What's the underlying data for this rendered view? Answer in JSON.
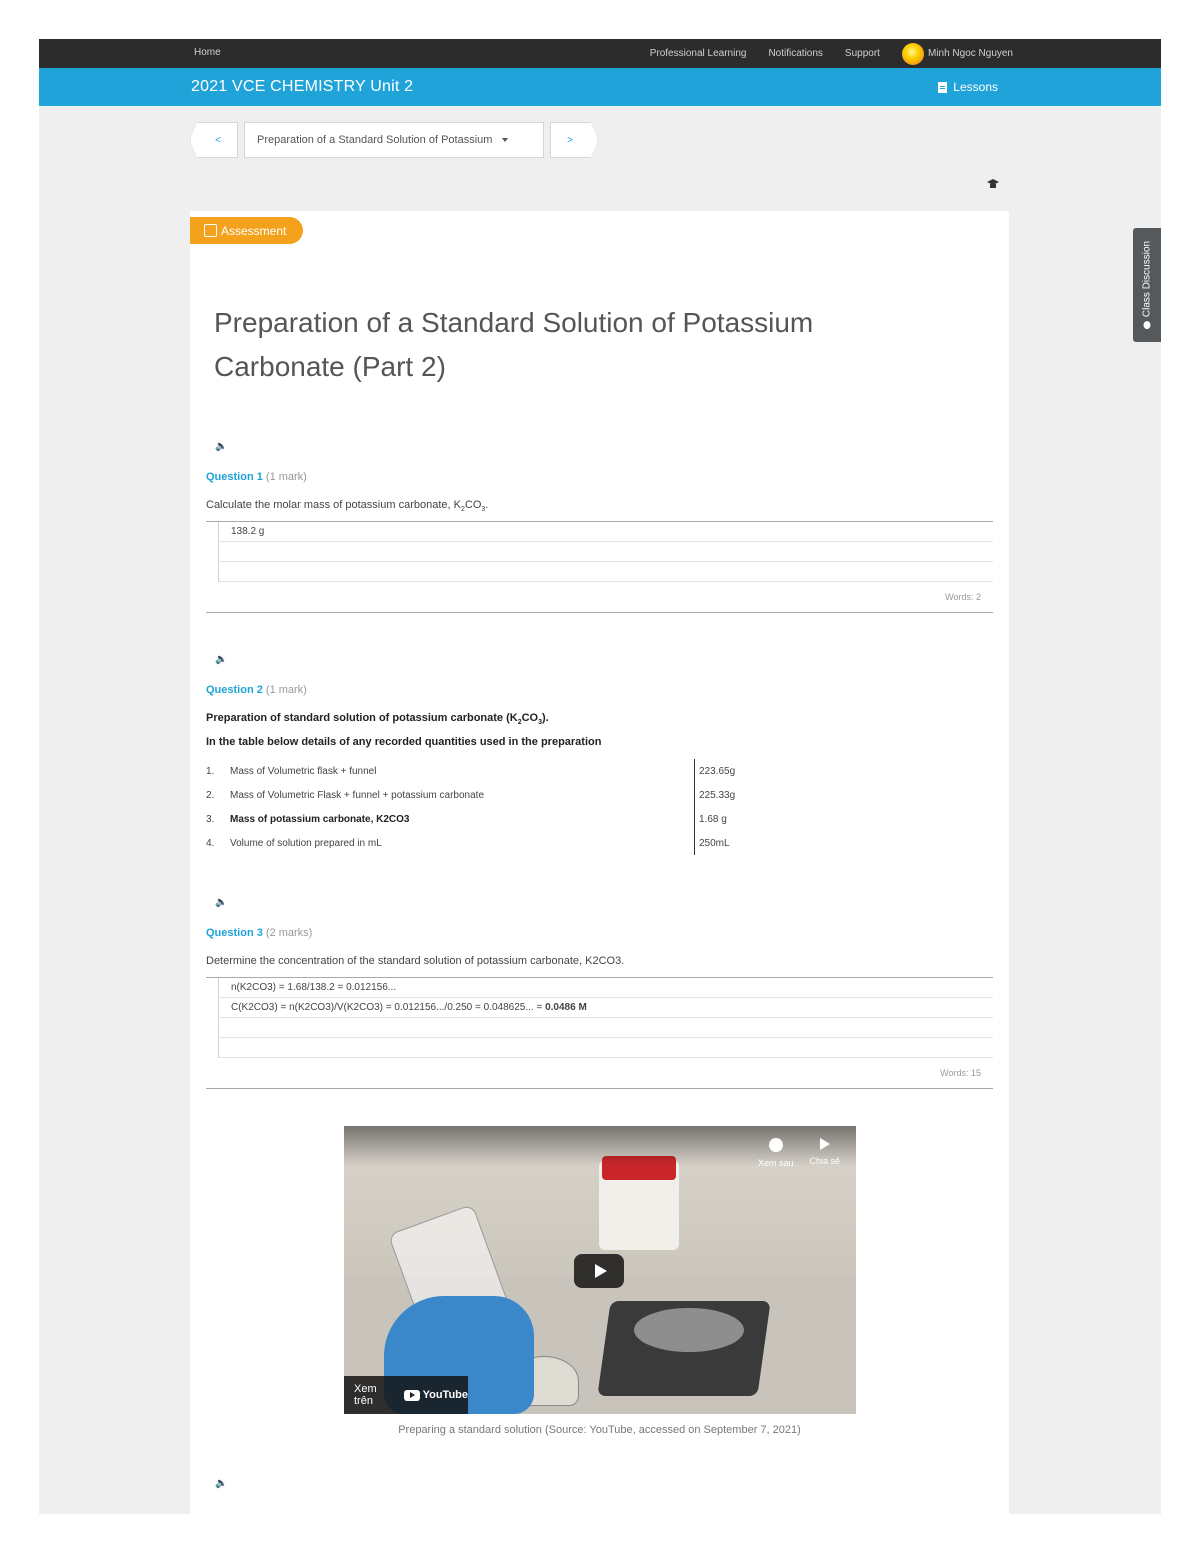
{
  "topnav": {
    "home": "Home",
    "links": [
      "Professional Learning",
      "Notifications",
      "Support"
    ],
    "user_name": "Minh Ngoc Nguyen"
  },
  "coursebar": {
    "title": "2021 VCE CHEMISTRY Unit 2",
    "lessons_label": "Lessons"
  },
  "lessonnav": {
    "prev_label": "<",
    "current_lesson": "Preparation of a Standard Solution of Potassium",
    "next_label": ">"
  },
  "sidetab": {
    "label": "Class Discussion"
  },
  "card": {
    "badge": "Assessment",
    "title": "Preparation of a Standard Solution of Potassium Carbonate (Part 2)"
  },
  "questions": [
    {
      "label": "Question 1",
      "marks": "(1 mark)",
      "text_before": "Calculate the molar mass of potassium carbonate, K",
      "text_sub1": "2",
      "text_mid": "CO",
      "text_sub2": "3",
      "text_after": ".",
      "answer_lines": [
        "138.2 g"
      ],
      "words": "Words: 2"
    },
    {
      "label": "Question 2",
      "marks": "(1 mark)",
      "heading_before": "Preparation of standard solution of potassium carbonate (K",
      "heading_sub1": "2",
      "heading_mid": "CO",
      "heading_sub2": "3",
      "heading_after": ").",
      "subheading": "In the table below details of any recorded quantities used in the preparation",
      "table": [
        {
          "num": "1.",
          "label": "Mass of Volumetric flask + funnel",
          "value": "223.65g"
        },
        {
          "num": "2.",
          "label": "Mass of Volumetric Flask + funnel + potassium carbonate",
          "value": "225.33g"
        },
        {
          "num": "3.",
          "label": "Mass of potassium carbonate, K2CO3",
          "value": "1.68 g"
        },
        {
          "num": "4.",
          "label": "Volume of solution prepared in mL",
          "value": "250mL"
        }
      ]
    },
    {
      "label": "Question 3",
      "marks": "(2 marks)",
      "text": "Determine the concentration of the standard solution of potassium carbonate, K2CO3.",
      "answer_lines": [
        "n(K2CO3) = 1.68/138.2 = 0.012156...",
        "C(K2CO3) = n(K2CO3)/V(K2CO3) = 0.012156.../0.250 = 0.048625... = ",
        "0.0486 M"
      ],
      "words": "Words: 15"
    }
  ],
  "video": {
    "watch_later": "Xem sau",
    "share": "Chia sẻ",
    "watch_on": "Xem trên",
    "youtube": "YouTube",
    "caption": "Preparing a standard solution (Source: YouTube, accessed on September 7, 2021)"
  }
}
